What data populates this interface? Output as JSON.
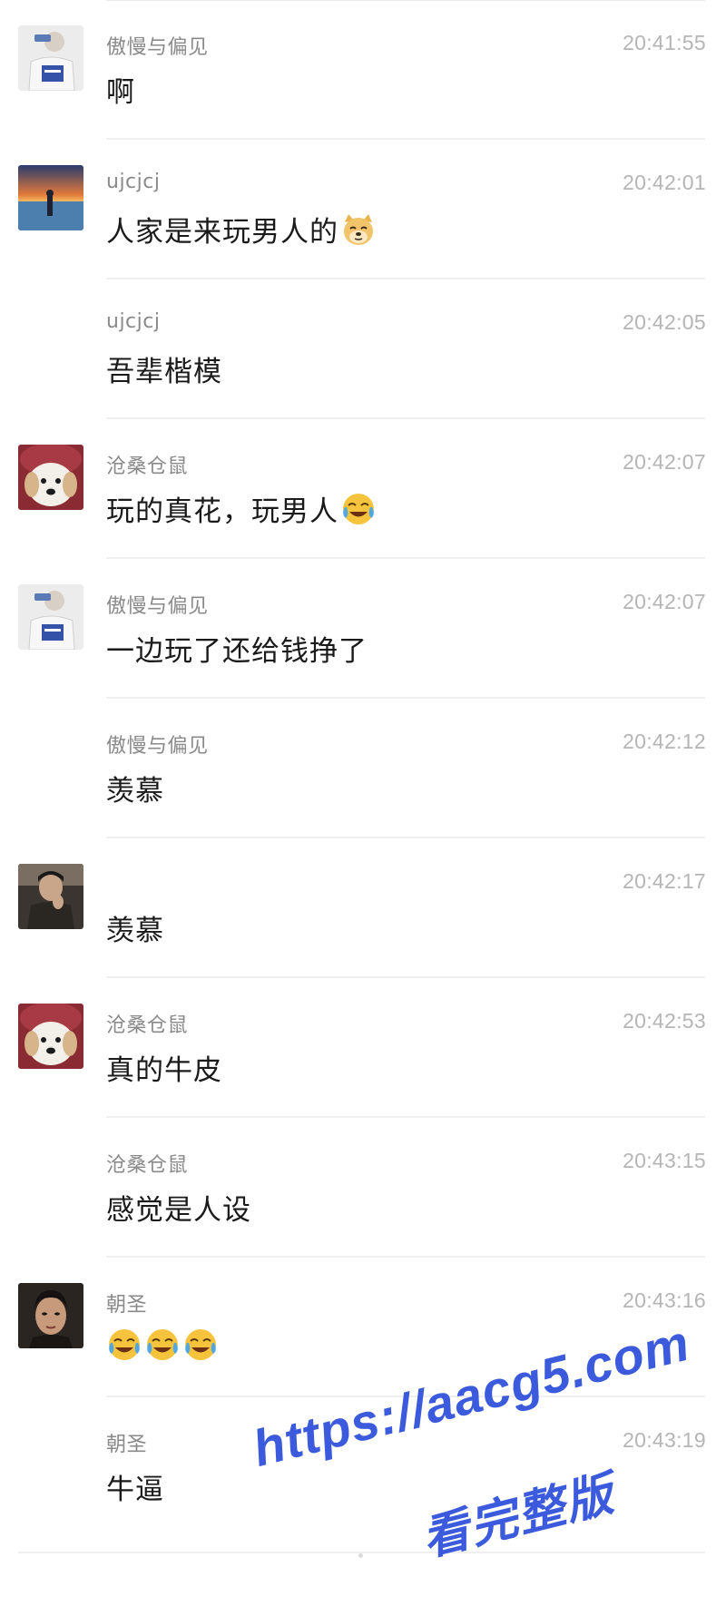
{
  "messages": [
    {
      "avatar": "avatar-guy-white-shirt",
      "sender": "傲慢与偏见",
      "time": "20:41:55",
      "text": "啊",
      "emoji": []
    },
    {
      "avatar": "avatar-sunset-sea",
      "sender": "ujcjcj",
      "time": "20:42:01",
      "text": "人家是来玩男人的",
      "emoji": [
        "doge-emoji"
      ]
    },
    {
      "avatar": "",
      "sender": "ujcjcj",
      "time": "20:42:05",
      "text": "吾辈楷模",
      "emoji": []
    },
    {
      "avatar": "avatar-dog-red-hat",
      "sender": "沧桑仓鼠",
      "time": "20:42:07",
      "text": "玩的真花，玩男人",
      "emoji": [
        "laugh-cry-emoji"
      ]
    },
    {
      "avatar": "avatar-guy-white-shirt",
      "sender": "傲慢与偏见",
      "time": "20:42:07",
      "text": "一边玩了还给钱挣了",
      "emoji": []
    },
    {
      "avatar": "",
      "sender": "傲慢与偏见",
      "time": "20:42:12",
      "text": "羡慕",
      "emoji": []
    },
    {
      "avatar": "avatar-dark-portrait",
      "sender": "",
      "time": "20:42:17",
      "text": "羡慕",
      "emoji": []
    },
    {
      "avatar": "avatar-dog-red-hat",
      "sender": "沧桑仓鼠",
      "time": "20:42:53",
      "text": "真的牛皮",
      "emoji": []
    },
    {
      "avatar": "",
      "sender": "沧桑仓鼠",
      "time": "20:43:15",
      "text": "感觉是人设",
      "emoji": []
    },
    {
      "avatar": "avatar-man-portrait",
      "sender": "朝圣",
      "time": "20:43:16",
      "text": "",
      "emoji": [
        "laugh-cry-emoji",
        "laugh-cry-emoji",
        "laugh-cry-emoji"
      ]
    },
    {
      "avatar": "",
      "sender": "朝圣",
      "time": "20:43:19",
      "text": "牛逼",
      "emoji": []
    }
  ],
  "watermark": {
    "url": "https://aacg5.com",
    "subtitle": "看完整版",
    "color": "#3b5bdc"
  },
  "colors": {
    "sender": "#8a8a8a",
    "time": "#b5b5b5",
    "text": "#1a1a1a",
    "divider": "#efefef"
  }
}
